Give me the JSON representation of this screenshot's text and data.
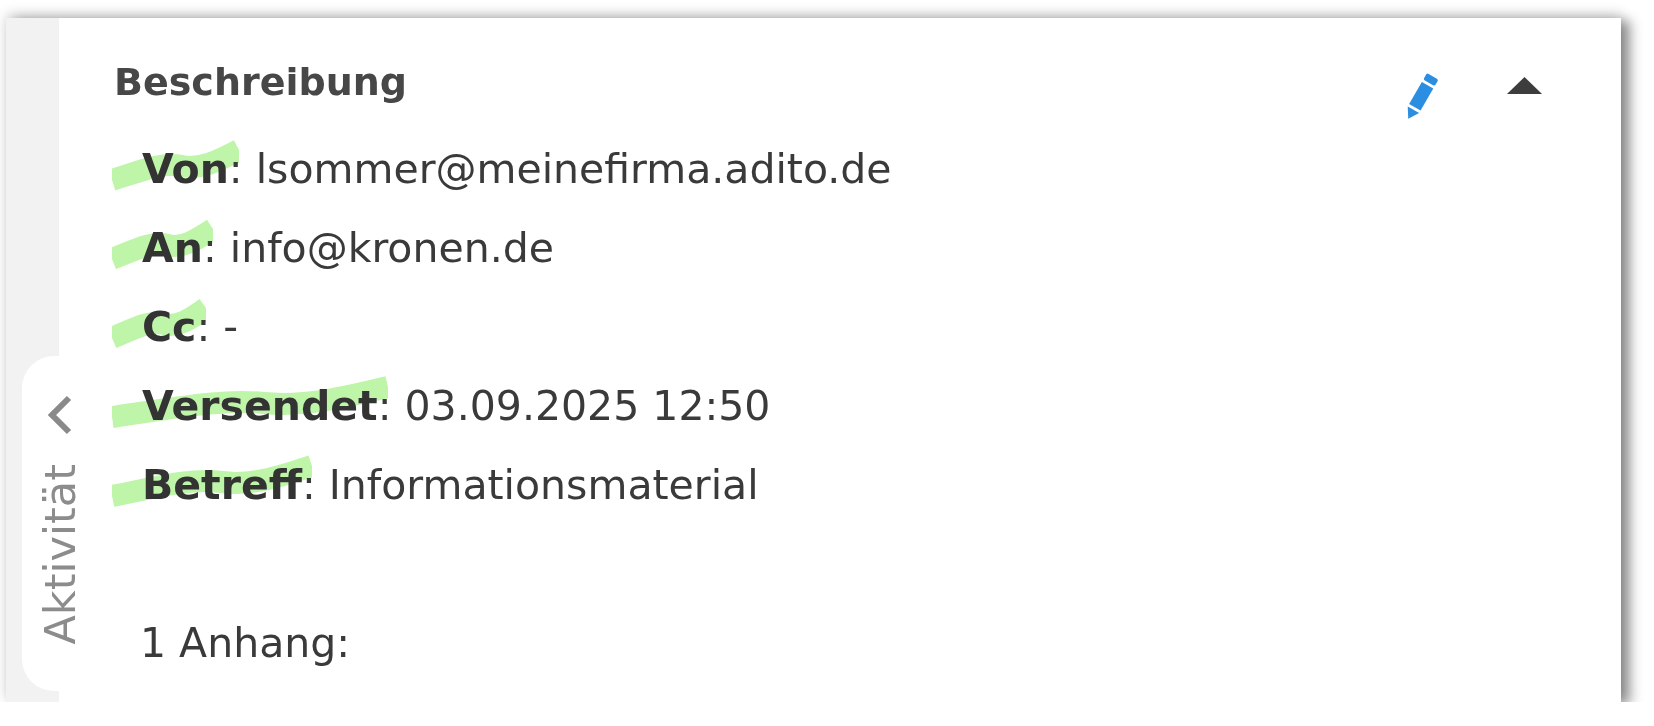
{
  "side_tab": {
    "label": "Aktivität"
  },
  "section": {
    "title": "Beschreibung",
    "expanded": true,
    "fields": [
      {
        "text": "**Von**: lsommer@meinefirma.adito.de",
        "highlighted": true
      },
      {
        "text": "**An**: info@kronen.de",
        "highlighted": true
      },
      {
        "text": "**Cc**: -",
        "highlighted": true
      },
      {
        "text": "**Versendet**: 03.09.2025 12:50",
        "highlighted": true
      },
      {
        "text": "**Betreff**: Informationsmaterial",
        "highlighted": true
      }
    ],
    "attachments": "1 Anhang:"
  }
}
